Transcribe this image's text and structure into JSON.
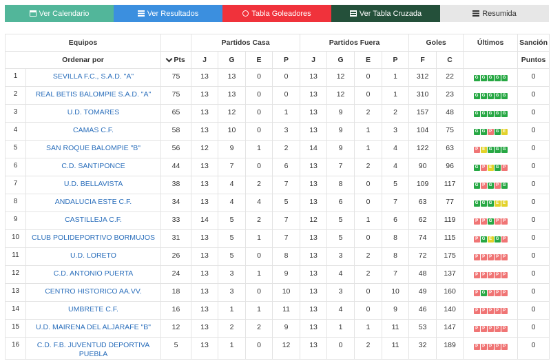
{
  "nav": {
    "tabs": [
      {
        "label": "Ver Calendario",
        "icon": "calendar-icon"
      },
      {
        "label": "Ver Resultados",
        "icon": "list-icon"
      },
      {
        "label": "Tabla Goleadores",
        "icon": "soccer-ball-icon"
      },
      {
        "label": "Ver Tabla Cruzada",
        "icon": "table-icon"
      },
      {
        "label": "Resumida",
        "icon": "list-icon"
      }
    ]
  },
  "table": {
    "groups": {
      "equipos": "Equipos",
      "casa": "Partidos Casa",
      "fuera": "Partidos Fuera",
      "goles": "Goles",
      "ultimos": "Últimos",
      "sancion": "Sanción"
    },
    "subheaders": {
      "order_by": "Ordenar por",
      "pts": "Pts",
      "j": "J",
      "g": "G",
      "e": "E",
      "p": "P",
      "f": "F",
      "c": "C",
      "puntos": "Puntos"
    },
    "colors": {
      "win": "#27a844",
      "loss": "#f07575",
      "draw": "#e3d22a",
      "link": "#2a6ebb"
    },
    "rows": [
      {
        "pos": "1",
        "team": "SEVILLA F.C., S.A.D. \"A\"",
        "pts": "75",
        "hj": "13",
        "hg": "13",
        "he": "0",
        "hp": "0",
        "aj": "13",
        "ag": "12",
        "ae": "0",
        "ap": "1",
        "f": "312",
        "c": "22",
        "last": [
          "G",
          "G",
          "G",
          "G",
          "G"
        ],
        "sancion": "0"
      },
      {
        "pos": "2",
        "team": "REAL BETIS BALOMPIE S.A.D. \"A\"",
        "pts": "75",
        "hj": "13",
        "hg": "13",
        "he": "0",
        "hp": "0",
        "aj": "13",
        "ag": "12",
        "ae": "0",
        "ap": "1",
        "f": "310",
        "c": "23",
        "last": [
          "G",
          "G",
          "G",
          "G",
          "G"
        ],
        "sancion": "0"
      },
      {
        "pos": "3",
        "team": "U.D. TOMARES",
        "pts": "65",
        "hj": "13",
        "hg": "12",
        "he": "0",
        "hp": "1",
        "aj": "13",
        "ag": "9",
        "ae": "2",
        "ap": "2",
        "f": "157",
        "c": "48",
        "last": [
          "G",
          "G",
          "G",
          "G",
          "G"
        ],
        "sancion": "0"
      },
      {
        "pos": "4",
        "team": "CAMAS C.F.",
        "pts": "58",
        "hj": "13",
        "hg": "10",
        "he": "0",
        "hp": "3",
        "aj": "13",
        "ag": "9",
        "ae": "1",
        "ap": "3",
        "f": "104",
        "c": "75",
        "last": [
          "G",
          "G",
          "P",
          "G",
          "E"
        ],
        "sancion": "0"
      },
      {
        "pos": "5",
        "team": "SAN ROQUE BALOMPIE \"B\"",
        "pts": "56",
        "hj": "12",
        "hg": "9",
        "he": "1",
        "hp": "2",
        "aj": "14",
        "ag": "9",
        "ae": "1",
        "ap": "4",
        "f": "122",
        "c": "63",
        "last": [
          "P",
          "E",
          "G",
          "G",
          "G"
        ],
        "sancion": "0"
      },
      {
        "pos": "6",
        "team": "C.D. SANTIPONCE",
        "pts": "44",
        "hj": "13",
        "hg": "7",
        "he": "0",
        "hp": "6",
        "aj": "13",
        "ag": "7",
        "ae": "2",
        "ap": "4",
        "f": "90",
        "c": "96",
        "last": [
          "G",
          "P",
          "E",
          "G",
          "P"
        ],
        "sancion": "0"
      },
      {
        "pos": "7",
        "team": "U.D. BELLAVISTA",
        "pts": "38",
        "hj": "13",
        "hg": "4",
        "he": "2",
        "hp": "7",
        "aj": "13",
        "ag": "8",
        "ae": "0",
        "ap": "5",
        "f": "109",
        "c": "117",
        "last": [
          "G",
          "P",
          "G",
          "P",
          "G"
        ],
        "sancion": "0"
      },
      {
        "pos": "8",
        "team": "ANDALUCIA ESTE C.F.",
        "pts": "34",
        "hj": "13",
        "hg": "4",
        "he": "4",
        "hp": "5",
        "aj": "13",
        "ag": "6",
        "ae": "0",
        "ap": "7",
        "f": "63",
        "c": "77",
        "last": [
          "G",
          "G",
          "G",
          "E",
          "E"
        ],
        "sancion": "0"
      },
      {
        "pos": "9",
        "team": "CASTILLEJA C.F.",
        "pts": "33",
        "hj": "14",
        "hg": "5",
        "he": "2",
        "hp": "7",
        "aj": "12",
        "ag": "5",
        "ae": "1",
        "ap": "6",
        "f": "62",
        "c": "119",
        "last": [
          "P",
          "P",
          "G",
          "P",
          "P"
        ],
        "sancion": "0"
      },
      {
        "pos": "10",
        "team": "CLUB POLIDEPORTIVO BORMUJOS",
        "pts": "31",
        "hj": "13",
        "hg": "5",
        "he": "1",
        "hp": "7",
        "aj": "13",
        "ag": "5",
        "ae": "0",
        "ap": "8",
        "f": "74",
        "c": "115",
        "last": [
          "P",
          "G",
          "E",
          "G",
          "P"
        ],
        "sancion": "0"
      },
      {
        "pos": "11",
        "team": "U.D. LORETO",
        "pts": "26",
        "hj": "13",
        "hg": "5",
        "he": "0",
        "hp": "8",
        "aj": "13",
        "ag": "3",
        "ae": "2",
        "ap": "8",
        "f": "72",
        "c": "175",
        "last": [
          "P",
          "P",
          "P",
          "P",
          "P"
        ],
        "sancion": "0"
      },
      {
        "pos": "12",
        "team": "C.D. ANTONIO PUERTA",
        "pts": "24",
        "hj": "13",
        "hg": "3",
        "he": "1",
        "hp": "9",
        "aj": "13",
        "ag": "4",
        "ae": "2",
        "ap": "7",
        "f": "48",
        "c": "137",
        "last": [
          "P",
          "P",
          "P",
          "P",
          "P"
        ],
        "sancion": "0"
      },
      {
        "pos": "13",
        "team": "CENTRO HISTORICO AA.VV.",
        "pts": "18",
        "hj": "13",
        "hg": "3",
        "he": "0",
        "hp": "10",
        "aj": "13",
        "ag": "3",
        "ae": "0",
        "ap": "10",
        "f": "49",
        "c": "160",
        "last": [
          "P",
          "G",
          "P",
          "P",
          "P"
        ],
        "sancion": "0"
      },
      {
        "pos": "14",
        "team": "UMBRETE C.F.",
        "pts": "16",
        "hj": "13",
        "hg": "1",
        "he": "1",
        "hp": "11",
        "aj": "13",
        "ag": "4",
        "ae": "0",
        "ap": "9",
        "f": "46",
        "c": "140",
        "last": [
          "P",
          "P",
          "P",
          "P",
          "P"
        ],
        "sancion": "0"
      },
      {
        "pos": "15",
        "team": "U.D. MAIRENA DEL ALJARAFE \"B\"",
        "pts": "12",
        "hj": "13",
        "hg": "2",
        "he": "2",
        "hp": "9",
        "aj": "13",
        "ag": "1",
        "ae": "1",
        "ap": "11",
        "f": "53",
        "c": "147",
        "last": [
          "P",
          "P",
          "P",
          "P",
          "P"
        ],
        "sancion": "0"
      },
      {
        "pos": "16",
        "team": "C.D. F.B. JUVENTUD DEPORTIVA PUEBLA",
        "pts": "5",
        "hj": "13",
        "hg": "1",
        "he": "0",
        "hp": "12",
        "aj": "13",
        "ag": "0",
        "ae": "2",
        "ap": "11",
        "f": "32",
        "c": "189",
        "last": [
          "P",
          "P",
          "P",
          "P",
          "P"
        ],
        "sancion": "0"
      }
    ]
  }
}
